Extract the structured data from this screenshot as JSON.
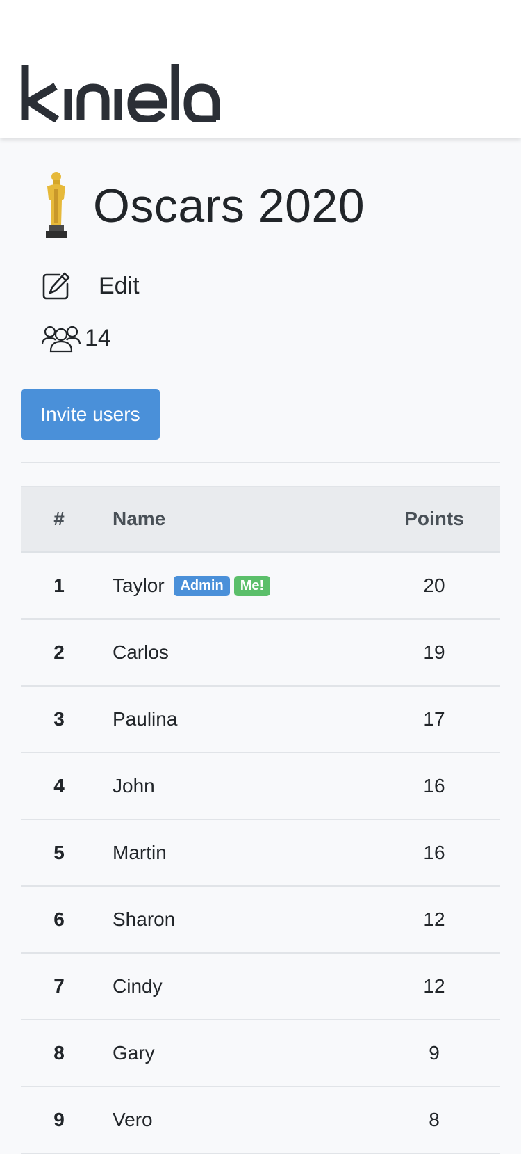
{
  "brand": {
    "logo_text": "kiniela"
  },
  "page": {
    "title": "Oscars 2020",
    "edit_label": "Edit",
    "members_count": "14",
    "invite_label": "Invite users"
  },
  "icons": {
    "trophy": "oscar-trophy-icon",
    "edit": "edit-icon",
    "members": "users-group-icon"
  },
  "colors": {
    "primary": "#4a90d9",
    "success": "#5bbf6a",
    "trophy_gold": "#e6b93a"
  },
  "table": {
    "headers": {
      "rank": "#",
      "name": "Name",
      "points": "Points"
    },
    "rows": [
      {
        "rank": "1",
        "name": "Taylor",
        "points": "20",
        "badges": [
          "Admin",
          "Me!"
        ]
      },
      {
        "rank": "2",
        "name": "Carlos",
        "points": "19"
      },
      {
        "rank": "3",
        "name": "Paulina",
        "points": "17"
      },
      {
        "rank": "4",
        "name": "John",
        "points": "16"
      },
      {
        "rank": "5",
        "name": "Martin",
        "points": "16"
      },
      {
        "rank": "6",
        "name": "Sharon",
        "points": "12"
      },
      {
        "rank": "7",
        "name": "Cindy",
        "points": "12"
      },
      {
        "rank": "8",
        "name": "Gary",
        "points": "9"
      },
      {
        "rank": "9",
        "name": "Vero",
        "points": "8"
      }
    ]
  }
}
